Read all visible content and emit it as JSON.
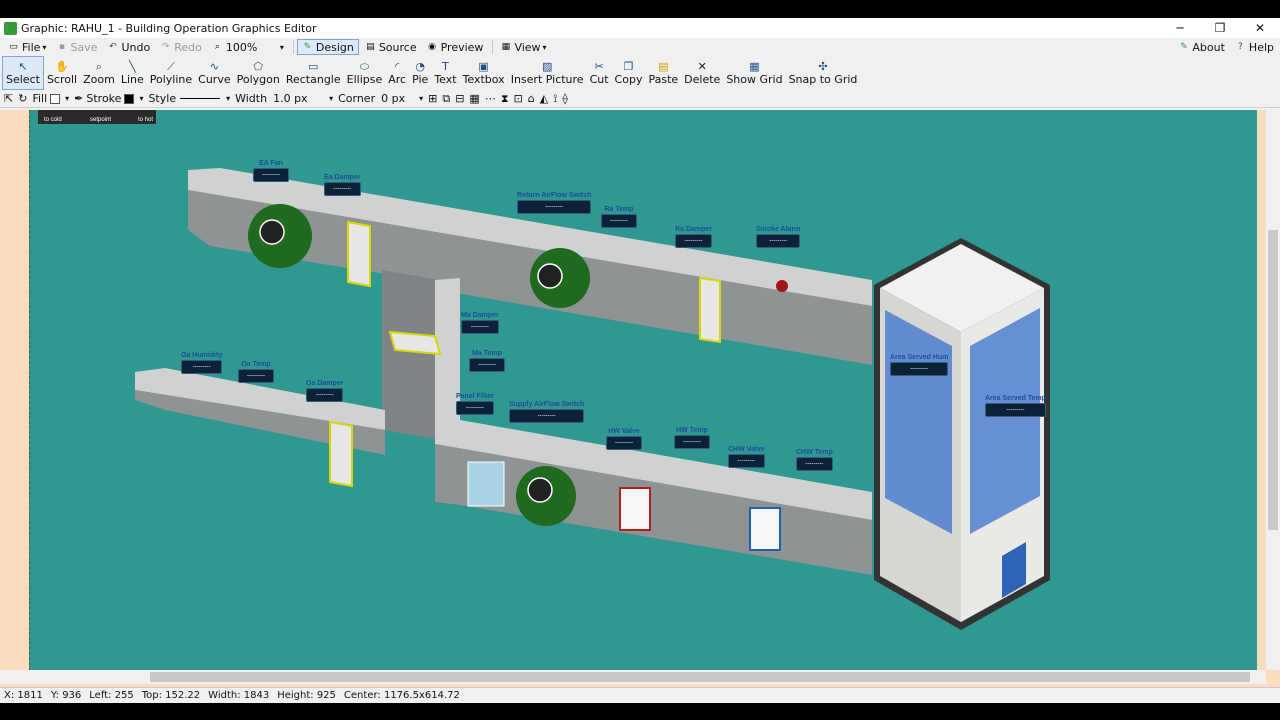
{
  "window": {
    "title": "Graphic: RAHU_1 - Building Operation Graphics Editor",
    "minimize": "─",
    "maximize": "❐",
    "close": "✕"
  },
  "menubar": {
    "file": "File",
    "save": "Save",
    "undo": "Undo",
    "redo": "Redo",
    "zoom": "100%",
    "design": "Design",
    "source": "Source",
    "preview": "Preview",
    "view": "View",
    "about": "About",
    "help": "Help"
  },
  "toolbar": {
    "select": "Select",
    "scroll": "Scroll",
    "zoom": "Zoom",
    "line": "Line",
    "polyline": "Polyline",
    "curve": "Curve",
    "polygon": "Polygon",
    "rectangle": "Rectangle",
    "ellipse": "Ellipse",
    "arc": "Arc",
    "pie": "Pie",
    "text": "Text",
    "textbox": "Textbox",
    "insert_picture": "Insert Picture",
    "cut": "Cut",
    "copy": "Copy",
    "paste": "Paste",
    "delete": "Delete",
    "show_grid": "Show Grid",
    "snap_to_grid": "Snap to Grid"
  },
  "propbar": {
    "fill": "Fill",
    "stroke": "Stroke",
    "style": "Style",
    "width": "Width",
    "width_value": "1.0 px",
    "corner": "Corner",
    "corner_value": "0 px"
  },
  "legend": {
    "cold": "to cold",
    "setpoint": "setpoint",
    "hot": "to hot"
  },
  "labels": {
    "ea_fan": "EA Fan",
    "ea_damper": "Ea Damper",
    "return_airflow": "Return AirFlow Switch",
    "ra_temp": "Ra Temp",
    "ra_damper": "Ra Damper",
    "smoke_alarm": "Smoke Alarm",
    "ma_damper": "Ma Damper",
    "ma_temp": "Ma Temp",
    "oa_humidity": "Oa Humidity",
    "oa_temp": "Oa Temp",
    "oa_damper": "Oa Damper",
    "panel_filter": "Panel Filter",
    "supply_airflow": "Supply AirFlow Switch",
    "hw_valve": "HW Valve",
    "hw_temp": "HW Temp",
    "chw_valve": "CHW Valve",
    "chw_temp": "CHW Temp",
    "area_hum": "Area Served Hum",
    "area_temp": "Area Served Temp"
  },
  "placeholder_value": "---------",
  "status": {
    "x": "X: 1811",
    "y": "Y: 936",
    "left": "Left: 255",
    "top": "Top: 152.22",
    "width": "Width: 1843",
    "height": "Height: 925",
    "center": "Center: 1176.5x614.72"
  }
}
